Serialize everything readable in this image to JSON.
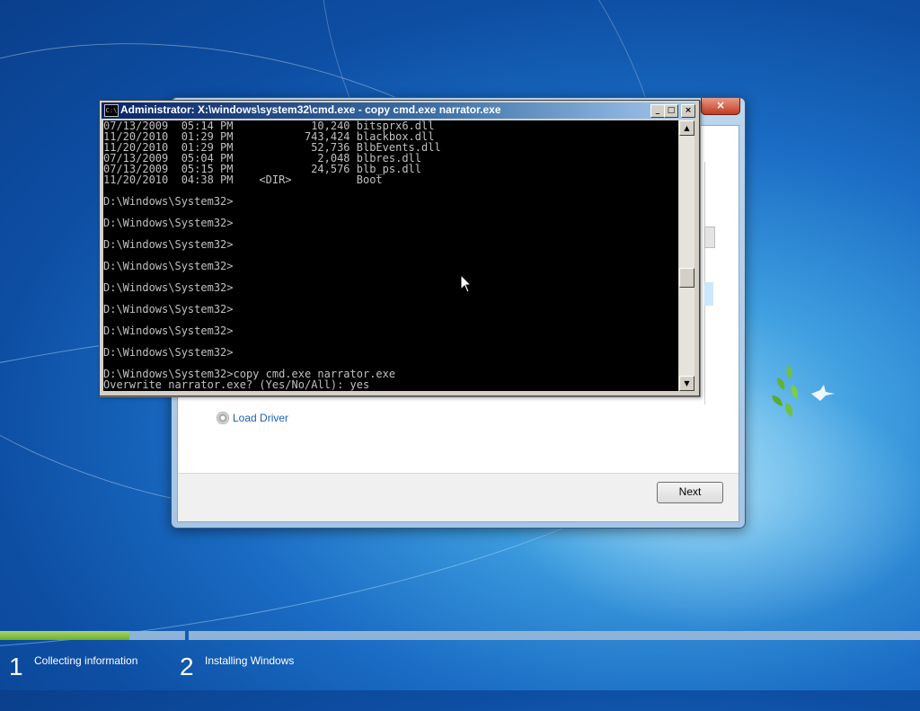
{
  "cmd": {
    "title": "Administrator: X:\\windows\\system32\\cmd.exe - copy  cmd.exe narrator.exe",
    "icon_text": "C:\\",
    "lines": [
      "07/13/2009  05:14 PM            10,240 bitsprx6.dll",
      "11/20/2010  01:29 PM           743,424 blackbox.dll",
      "11/20/2010  01:29 PM            52,736 BlbEvents.dll",
      "07/13/2009  05:04 PM             2,048 blbres.dll",
      "07/13/2009  05:15 PM            24,576 blb_ps.dll",
      "11/20/2010  04:38 PM    <DIR>          Boot",
      "",
      "D:\\Windows\\System32>",
      "",
      "D:\\Windows\\System32>",
      "",
      "D:\\Windows\\System32>",
      "",
      "D:\\Windows\\System32>",
      "",
      "D:\\Windows\\System32>",
      "",
      "D:\\Windows\\System32>",
      "",
      "D:\\Windows\\System32>",
      "",
      "D:\\Windows\\System32>",
      "",
      "D:\\Windows\\System32>copy cmd.exe narrator.exe",
      "Overwrite narrator.exe? (Yes/No/All): yes"
    ],
    "buttons": {
      "minimize": "_",
      "maximize": "□",
      "close": "×"
    }
  },
  "setup": {
    "close_label": "×",
    "load_driver_label": "Load Driver",
    "next_label": "Next"
  },
  "progress": {
    "steps": [
      {
        "number": "1",
        "label": "Collecting information"
      },
      {
        "number": "2",
        "label": "Installing Windows"
      }
    ],
    "step1_fraction": 0.7
  },
  "icons": [
    "cmd-icon",
    "disc-icon",
    "mouse-cursor-icon",
    "bird-icon"
  ]
}
